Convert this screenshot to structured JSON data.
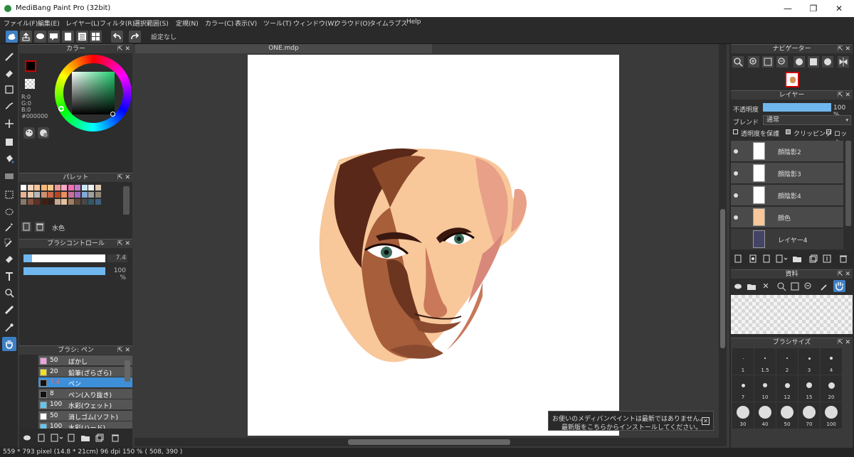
{
  "app": {
    "title": "MediBang Paint Pro (32bit)",
    "win_min": "—",
    "win_max": "❐",
    "win_close": "✕"
  },
  "menu": [
    "ファイル(F)",
    "編集(E)",
    "レイヤー(L)",
    "フィルタ(R)",
    "選択範囲(S)",
    "定規(N)",
    "カラー(C)",
    "表示(V)",
    "ツール(T)",
    "ウィンドウ(W)",
    "クラウド(O)",
    "タイムラプス",
    "Help"
  ],
  "toolbar": {
    "status_text": "設定なし"
  },
  "color_panel": {
    "title": "カラー",
    "r": "R:0",
    "g": "G:0",
    "b": "B:0",
    "hex": "#000000",
    "primary": "#000000",
    "secondary": "#ffffff"
  },
  "palette_panel": {
    "title": "パレット",
    "palette_name": "水色",
    "colors": [
      "#ffffff",
      "#f3d7c0",
      "#f6c49a",
      "#f8b878",
      "#f8c888",
      "#f09898",
      "#f8a8c8",
      "#f070b0",
      "#c878c8",
      "#c8e8f8",
      "#f0f0f0",
      "#e0c8b0",
      "#e8b090",
      "#e8c8a8",
      "#b8b8b8",
      "#d09070",
      "#c86848",
      "#b84820",
      "#e89060",
      "#c87098",
      "#a068c0",
      "#80a8d8",
      "#a0a0a0",
      "#908878",
      "#887868",
      "#805040",
      "#603020",
      "#402010",
      "#302018",
      "#c8a890",
      "#e8c0a0",
      "#a08060",
      "#604838",
      "#484848",
      "#305868",
      "#406080"
    ]
  },
  "brush_control": {
    "title": "ブラシコントロール",
    "size": "7.4",
    "opacity": "100 %",
    "size_fraction": 0.1,
    "opacity_fraction": 1.0
  },
  "brush_panel": {
    "title": "ブラシ: ペン",
    "items": [
      {
        "size": "50",
        "name": "ぼかし",
        "color": "#f0a0e0"
      },
      {
        "size": "20",
        "name": "鉛筆(ざらざら)",
        "color": "#f0e020"
      },
      {
        "size": "7.4",
        "name": "ペン",
        "color": "#111111",
        "selected": true
      },
      {
        "size": "8",
        "name": "ペン(入り抜き)",
        "color": "#111111"
      },
      {
        "size": "100",
        "name": "水彩(ウェット)",
        "color": "#60c8f0"
      },
      {
        "size": "50",
        "name": "消しゴム(ソフト)",
        "color": "#ffffff"
      },
      {
        "size": "100",
        "name": "水彩(ハード)",
        "color": "#60c8f0"
      }
    ]
  },
  "document": {
    "tab": "ONE.mdp"
  },
  "navigator": {
    "title": "ナビゲーター"
  },
  "layer_panel": {
    "title": "レイヤー",
    "opacity_label": "不透明度",
    "opacity_value": "100 %",
    "blend_label": "ブレンド",
    "blend_value": "通常",
    "protect_alpha": "透明度を保護",
    "clipping": "クリッピング",
    "lock": "ロック",
    "layers": [
      "顔陰影2",
      "顔陰影3",
      "顔陰影4",
      "顔色",
      "レイヤー4"
    ]
  },
  "materials_panel": {
    "title": "資料"
  },
  "brush_size_panel": {
    "title": "ブラシサイズ",
    "sizes": [
      "1",
      "1.5",
      "2",
      "3",
      "4",
      "7",
      "10",
      "12",
      "15",
      "20",
      "30",
      "40",
      "50",
      "70",
      "100"
    ]
  },
  "notification": {
    "line1": "お使いのメディバンペイントは最新ではありません。",
    "line2": "最新版をこちらからインストールしてください。"
  },
  "statusbar": {
    "text": "559 * 793 pixel   (14.8 * 21cm)   96 dpi   150 %   ( 508, 390 )"
  }
}
